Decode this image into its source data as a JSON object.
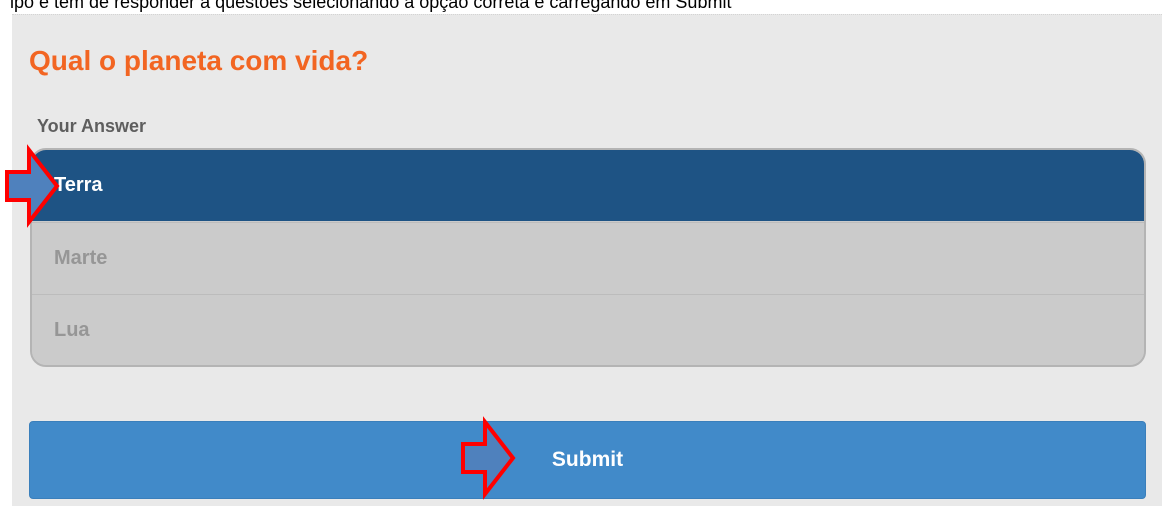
{
  "header_strip": {
    "cut_text": "lpo e tem de responder a questões selecionando a opção correta e carregando em Submit"
  },
  "question": {
    "title": "Qual o planeta com vida?",
    "answer_label": "Your Answer"
  },
  "options": [
    {
      "label": "Terra",
      "selected": true
    },
    {
      "label": "Marte",
      "selected": false
    },
    {
      "label": "Lua",
      "selected": false
    }
  ],
  "submit": {
    "label": "Submit"
  },
  "colors": {
    "title": "#f26522",
    "selected_option": "#1e5384",
    "unselected_option": "#cbcbcb",
    "submit_button": "#418ac9",
    "annotation_arrow_stroke": "#ff0000",
    "annotation_arrow_fill": "#4f81bd"
  },
  "annotations": {
    "arrow_icon": "arrow-right-icon"
  }
}
